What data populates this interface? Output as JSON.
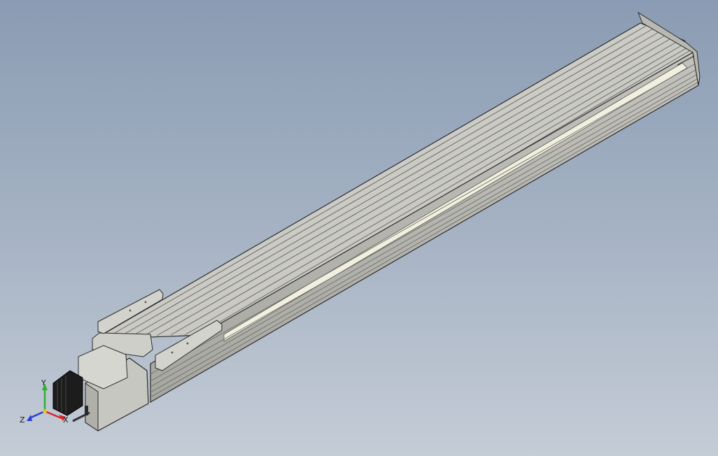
{
  "viewport": {
    "background_top": "#8a9cb3",
    "background_bottom": "#c4ccd6"
  },
  "model": {
    "name": "linear-actuator-module",
    "body_color": "#c9c9c4",
    "edge_color": "#2b2b2b",
    "rail_highlight": "#f1efdf",
    "motor_color": "#1c1c1c"
  },
  "triad": {
    "x_label": "X",
    "y_label": "Y",
    "z_label": "Z",
    "x_color": "#d7262a",
    "y_color": "#2fb02f",
    "z_color": "#2b3fd8"
  }
}
